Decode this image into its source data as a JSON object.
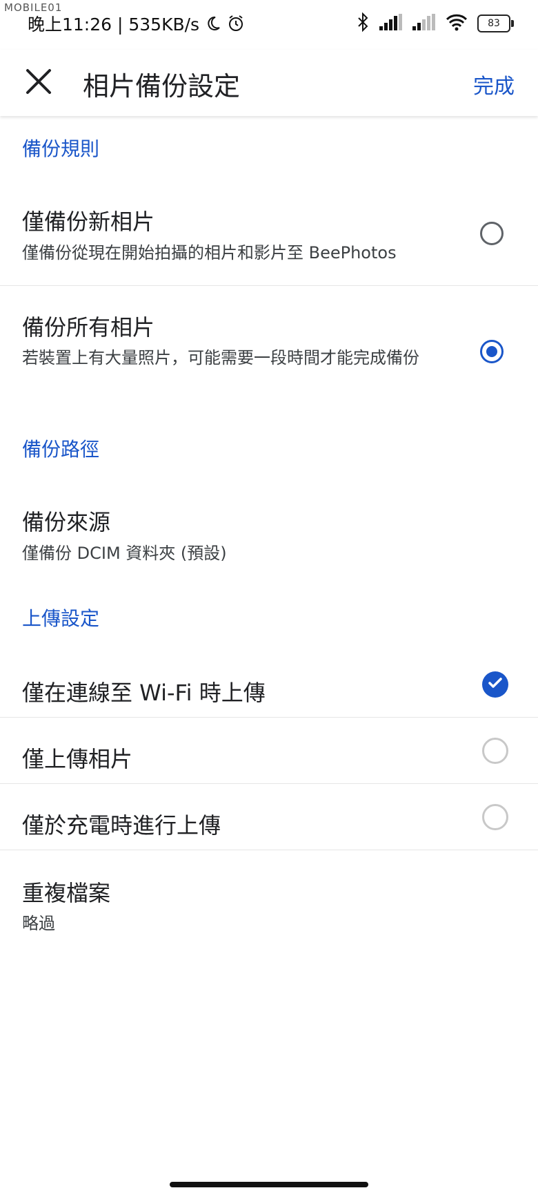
{
  "status_bar": {
    "watermark": "MOBILE01",
    "time": "晚上11:26",
    "speed": "535KB/s",
    "battery": "83"
  },
  "header": {
    "title": "相片備份設定",
    "done_label": "完成"
  },
  "sections": {
    "backup_rules": "備份規則",
    "backup_path": "備份路徑",
    "upload_settings": "上傳設定"
  },
  "backup_rules": {
    "new_only": {
      "title": "僅備份新相片",
      "subtitle": "僅備份從現在開始拍攝的相片和影片至 BeePhotos",
      "selected": false
    },
    "all": {
      "title": "備份所有相片",
      "subtitle": "若裝置上有大量照片，可能需要一段時間才能完成備份",
      "selected": true
    }
  },
  "backup_source": {
    "title": "備份來源",
    "subtitle": "僅備份 DCIM 資料夾 (預設)"
  },
  "upload": {
    "wifi_only": {
      "label": "僅在連線至 Wi-Fi 時上傳",
      "checked": true
    },
    "photos_only": {
      "label": "僅上傳相片",
      "checked": false
    },
    "charging_only": {
      "label": "僅於充電時進行上傳",
      "checked": false
    }
  },
  "duplicates": {
    "title": "重複檔案",
    "subtitle": "略過"
  },
  "colors": {
    "accent": "#1a56c9",
    "text": "#202124",
    "divider": "#e6e6e6"
  }
}
